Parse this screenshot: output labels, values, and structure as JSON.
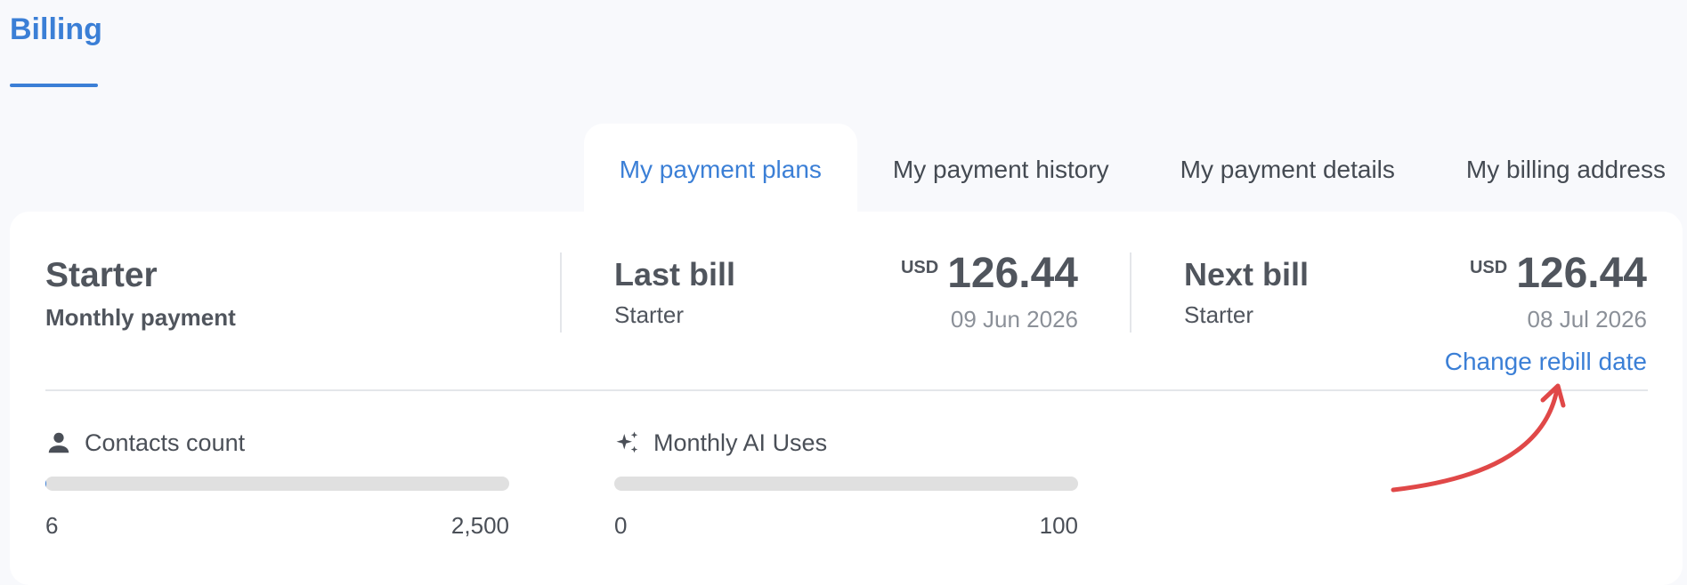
{
  "page": {
    "tab_label": "Billing"
  },
  "tabs": [
    {
      "label": "My payment plans",
      "active": true
    },
    {
      "label": "My payment history",
      "active": false
    },
    {
      "label": "My payment details",
      "active": false
    },
    {
      "label": "My billing address",
      "active": false
    }
  ],
  "plan": {
    "name": "Starter",
    "frequency": "Monthly payment"
  },
  "last_bill": {
    "title": "Last bill",
    "plan": "Starter",
    "currency": "USD",
    "amount": "126.44",
    "date": "09 Jun 2026"
  },
  "next_bill": {
    "title": "Next bill",
    "plan": "Starter",
    "currency": "USD",
    "amount": "126.44",
    "date": "08 Jul 2026",
    "link_label": "Change rebill date"
  },
  "usage": {
    "contacts": {
      "label": "Contacts count",
      "icon": "person-icon",
      "used": "6",
      "limit": "2,500",
      "fraction": 0.0024
    },
    "ai": {
      "label": "Monthly AI Uses",
      "icon": "sparkle-icon",
      "used": "0",
      "limit": "100",
      "fraction": 0
    }
  },
  "colors": {
    "accent": "#3b7fd6",
    "annotation_arrow": "#e04848"
  }
}
